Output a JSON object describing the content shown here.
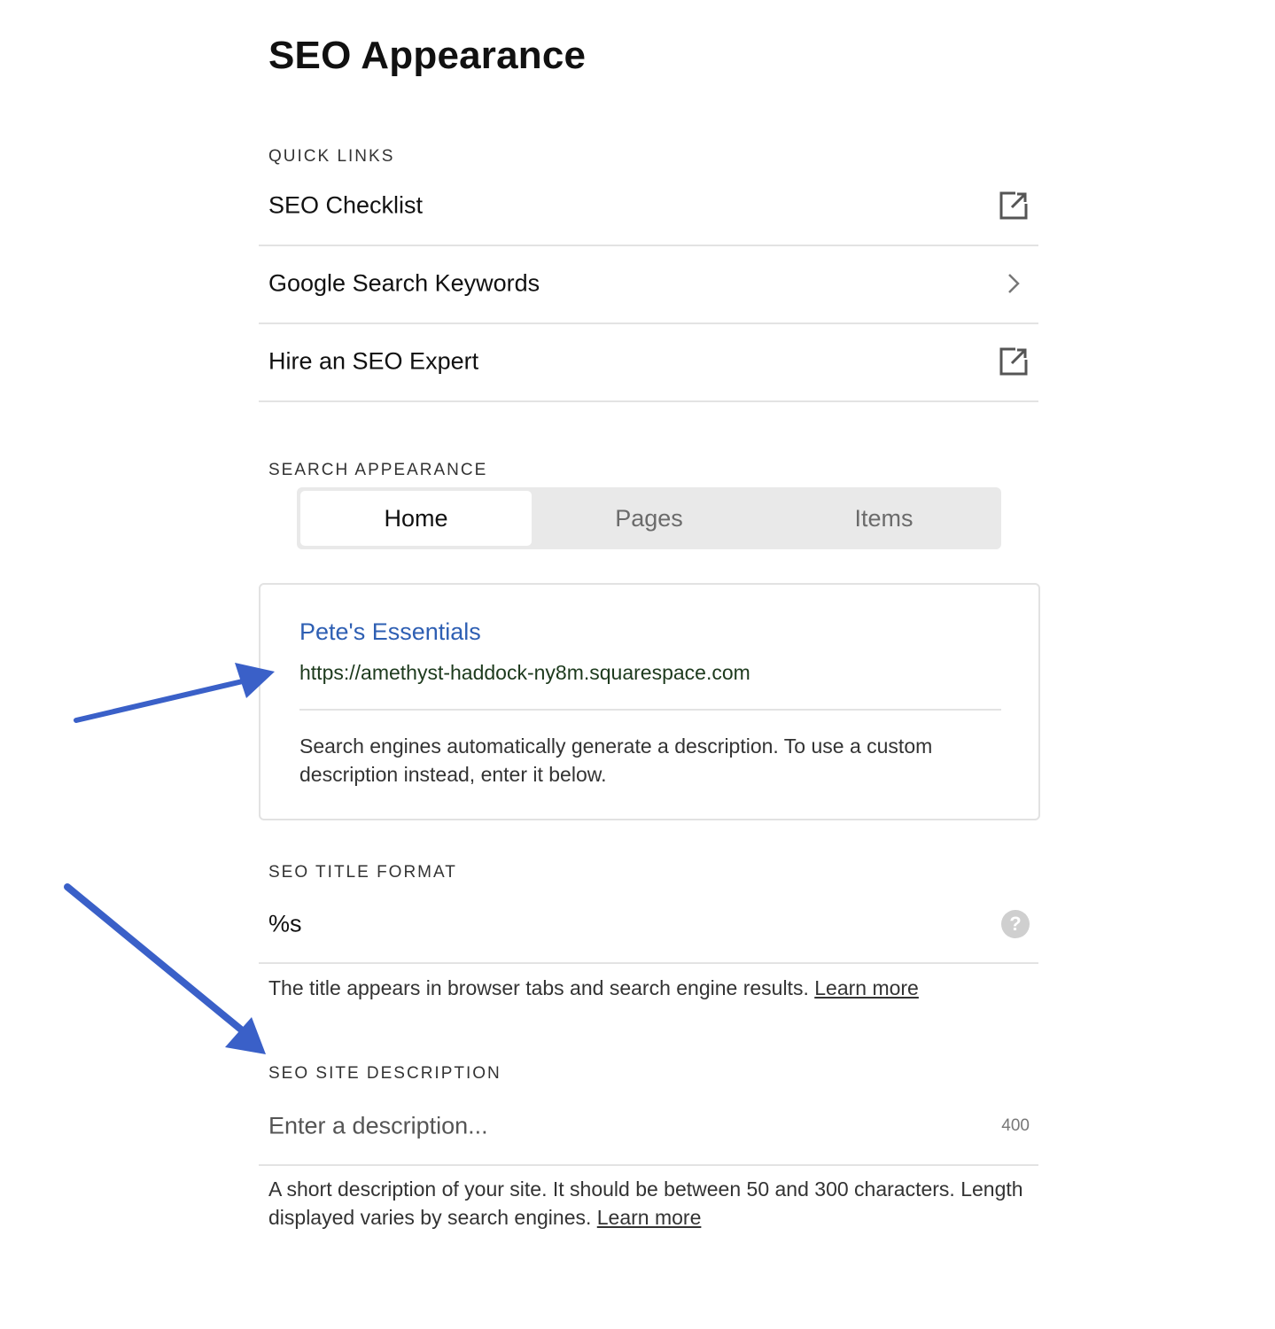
{
  "page": {
    "title": "SEO Appearance"
  },
  "quick_links": {
    "heading": "QUICK LINKS",
    "items": [
      {
        "label": "SEO Checklist",
        "icon": "external-link-icon"
      },
      {
        "label": "Google Search Keywords",
        "icon": "chevron-right-icon"
      },
      {
        "label": "Hire an SEO Expert",
        "icon": "external-link-icon"
      }
    ]
  },
  "search_appearance": {
    "heading": "SEARCH APPEARANCE",
    "tabs": [
      {
        "label": "Home",
        "active": true
      },
      {
        "label": "Pages",
        "active": false
      },
      {
        "label": "Items",
        "active": false
      }
    ],
    "preview": {
      "site_title": "Pete's Essentials",
      "url": "https://amethyst-haddock-ny8m.squarespace.com",
      "description": "Search engines automatically generate a description. To use a custom description instead, enter it below."
    }
  },
  "seo_title_format": {
    "heading": "SEO TITLE FORMAT",
    "value": "%s",
    "icon": "help-icon",
    "help_text": "The title appears in browser tabs and search engine results.",
    "learn_more": "Learn more"
  },
  "seo_site_description": {
    "heading": "SEO SITE DESCRIPTION",
    "placeholder": "Enter a description...",
    "value": "",
    "char_counter": "400",
    "help_text": "A short description of your site. It should be between 50 and 300 characters. Length displayed varies by search engines.",
    "learn_more": "Learn more"
  },
  "annotations": {
    "arrow_color": "#3a60c8",
    "arrows": [
      "arrow pointing to site URL in preview",
      "arrow pointing to SEO site description section"
    ]
  },
  "colors": {
    "link_blue": "#2e5fb3",
    "url_green": "#1d3a1d",
    "tab_background": "#e9e9e9"
  }
}
